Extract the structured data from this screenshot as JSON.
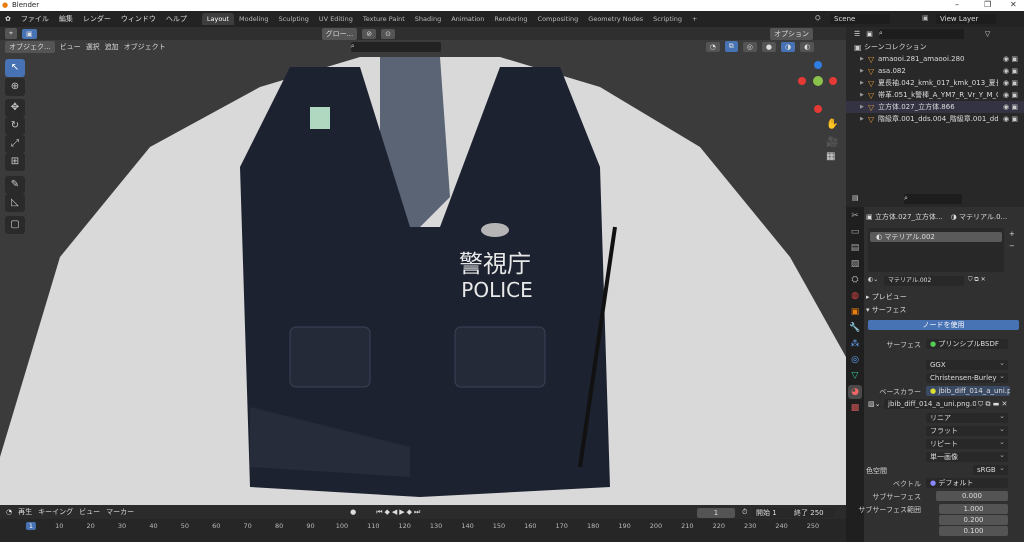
{
  "window": {
    "title": "Blender",
    "minimize": "–",
    "maximize": "❐",
    "close": "✕"
  },
  "menu": [
    "ファイル",
    "編集",
    "レンダー",
    "ウィンドウ",
    "ヘルプ"
  ],
  "workspaces": [
    "Layout",
    "Modeling",
    "Sculpting",
    "UV Editing",
    "Texture Paint",
    "Shading",
    "Animation",
    "Rendering",
    "Compositing",
    "Geometry Nodes",
    "Scripting",
    "+"
  ],
  "scene": {
    "label": "Scene",
    "view_layer": "View Layer"
  },
  "viewport": {
    "mode": "オブジェク...",
    "menus": [
      "ビュー",
      "選択",
      "追加",
      "オブジェクト"
    ],
    "transform": "グロー...",
    "options": "オプション"
  },
  "outliner": {
    "root": "シーンコレクション",
    "items": [
      "amaooi.281_amaooi.280",
      "asa.082",
      "夏長袖.042_kmk_017_kmk_013_夏長袖",
      "帯革.051_k警棒_A_YM7_R_Vr_Y_M_000",
      "立方体.027_立方体.866",
      "階級章.001_dds.004_階級章.001_dds.0"
    ]
  },
  "properties": {
    "object": "立方体.027_立方体...",
    "material_crumb": "マテリアル.0...",
    "slot": "マテリアル.002",
    "material": "マテリアル.002",
    "preview": "プレビュー",
    "surface_panel": "サーフェス",
    "use_nodes": "ノードを使用",
    "surface_label": "サーフェス",
    "surface_value": "プリンシプルBSDF",
    "distribution": "GGX",
    "subsurface_method": "Christensen-Burley",
    "base_color_label": "ベースカラー",
    "base_color_value": "jbib_diff_014_a_uni.png.0...",
    "image": "jbib_diff_014_a_uni.png.001",
    "interp": "リニア",
    "proj": "フラット",
    "ext": "リピート",
    "source": "単一画像",
    "colorspace_label": "色空間",
    "colorspace": "sRGB",
    "vector_label": "ベクトル",
    "vector": "デフォルト",
    "subsurface_label": "サブサーフェス",
    "subsurface": "0.000",
    "radius_label": "サブサーフェス範囲",
    "radius": [
      "1.000",
      "0.200",
      "0.100"
    ]
  },
  "timeline": {
    "menus": [
      "再生",
      "キーイング",
      "ビュー",
      "マーカー"
    ],
    "current": "1",
    "start_label": "開始",
    "start": "1",
    "end_label": "終了",
    "end": "250",
    "ticks": [
      "1",
      "10",
      "20",
      "30",
      "40",
      "50",
      "60",
      "70",
      "80",
      "90",
      "100",
      "110",
      "120",
      "130",
      "140",
      "150",
      "160",
      "170",
      "180",
      "190",
      "200",
      "210",
      "220",
      "230",
      "240",
      "250"
    ]
  },
  "scene_text": {
    "patch_kanji": "警視庁",
    "patch_police": "POLICE"
  }
}
